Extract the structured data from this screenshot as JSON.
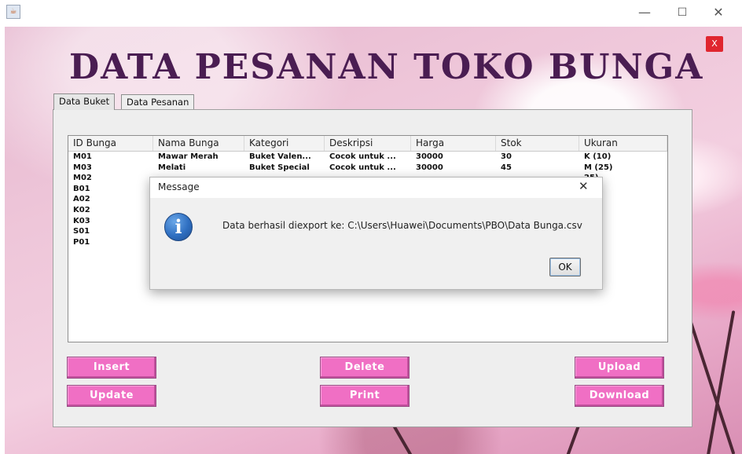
{
  "window": {
    "minimize_glyph": "—",
    "maximize_glyph": "☐",
    "close_glyph": "✕",
    "app_icon": "java-app-icon"
  },
  "app": {
    "title": "DATA PESANAN TOKO BUNGA",
    "close_label": "X"
  },
  "tabs": [
    {
      "label": "Data Buket",
      "selected": true
    },
    {
      "label": "Data Pesanan",
      "selected": false
    }
  ],
  "table": {
    "columns": [
      "ID Bunga",
      "Nama Bunga",
      "Kategori",
      "Deskripsi",
      "Harga",
      "Stok",
      "Ukuran"
    ],
    "rows": [
      [
        "M01",
        "Mawar Merah",
        "Buket Valen...",
        "Cocok untuk ...",
        "30000",
        "30",
        "K (10)"
      ],
      [
        "M03",
        "Melati",
        "Buket Special",
        "Cocok untuk ...",
        "30000",
        "45",
        "M (25)"
      ],
      [
        "M02",
        "",
        "",
        "",
        "",
        "",
        "25)"
      ],
      [
        "B01",
        "",
        "",
        "",
        "",
        "",
        "25)"
      ],
      [
        "A02",
        "",
        "",
        "",
        "",
        "",
        "25)"
      ],
      [
        "K02",
        "",
        "",
        "",
        "",
        "",
        "30)"
      ],
      [
        "K03",
        "",
        "",
        "",
        "",
        "",
        "10)"
      ],
      [
        "S01",
        "",
        "",
        "",
        "",
        "",
        "10)"
      ],
      [
        "P01",
        "",
        "",
        "",
        "",
        "",
        "25)"
      ]
    ]
  },
  "buttons": {
    "insert": "Insert",
    "update": "Update",
    "delete": "Delete",
    "print": "Print",
    "upload": "Upload",
    "download": "Download"
  },
  "dialog": {
    "title": "Message",
    "close_glyph": "✕",
    "icon": "info-icon",
    "icon_glyph": "i",
    "message": "Data berhasil diexport ke: C:\\Users\\Huawei\\Documents\\PBO\\Data Bunga.csv",
    "ok_label": "OK"
  },
  "colors": {
    "button_pink": "#f06fc4",
    "title_purple": "#4a1d52",
    "close_red": "#e0262f",
    "info_blue": "#2f6fc1"
  }
}
